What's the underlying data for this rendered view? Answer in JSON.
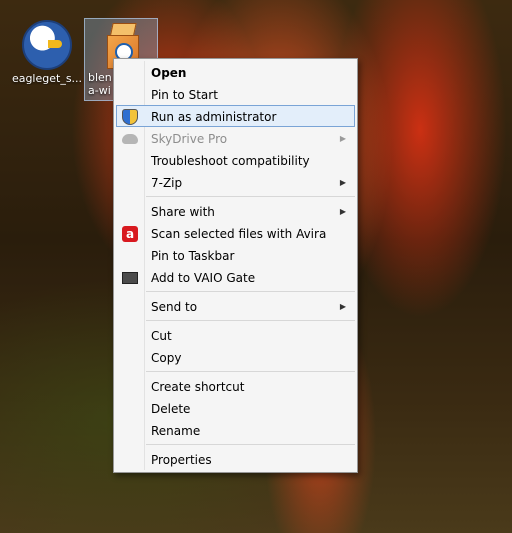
{
  "desktop": {
    "icons": [
      {
        "label": "eagleget_s...",
        "icon": "eagle-icon"
      },
      {
        "label": "blen\na-wi",
        "icon": "box-icon",
        "selected": true
      }
    ]
  },
  "context_menu": {
    "items": [
      {
        "label": "Open",
        "bold": true
      },
      {
        "label": "Pin to Start"
      },
      {
        "label": "Run as administrator",
        "icon": "shield-icon",
        "highlighted": true
      },
      {
        "label": "SkyDrive Pro",
        "icon": "cloud-icon",
        "disabled": true,
        "submenu": true
      },
      {
        "label": "Troubleshoot compatibility"
      },
      {
        "label": "7-Zip",
        "submenu": true
      },
      {
        "label": "Share with",
        "submenu": true
      },
      {
        "label": "Scan selected files with Avira",
        "icon": "avira-icon"
      },
      {
        "label": "Pin to Taskbar"
      },
      {
        "label": "Add to VAIO Gate",
        "icon": "vaio-icon"
      },
      {
        "label": "Send to",
        "submenu": true
      },
      {
        "label": "Cut"
      },
      {
        "label": "Copy"
      },
      {
        "label": "Create shortcut"
      },
      {
        "label": "Delete"
      },
      {
        "label": "Rename"
      },
      {
        "label": "Properties"
      }
    ],
    "submenu_arrow": "▶"
  },
  "colors": {
    "highlight_bg": "#e3eefa",
    "highlight_border": "#7aa4d6",
    "disabled_text": "#8d8d8d"
  }
}
